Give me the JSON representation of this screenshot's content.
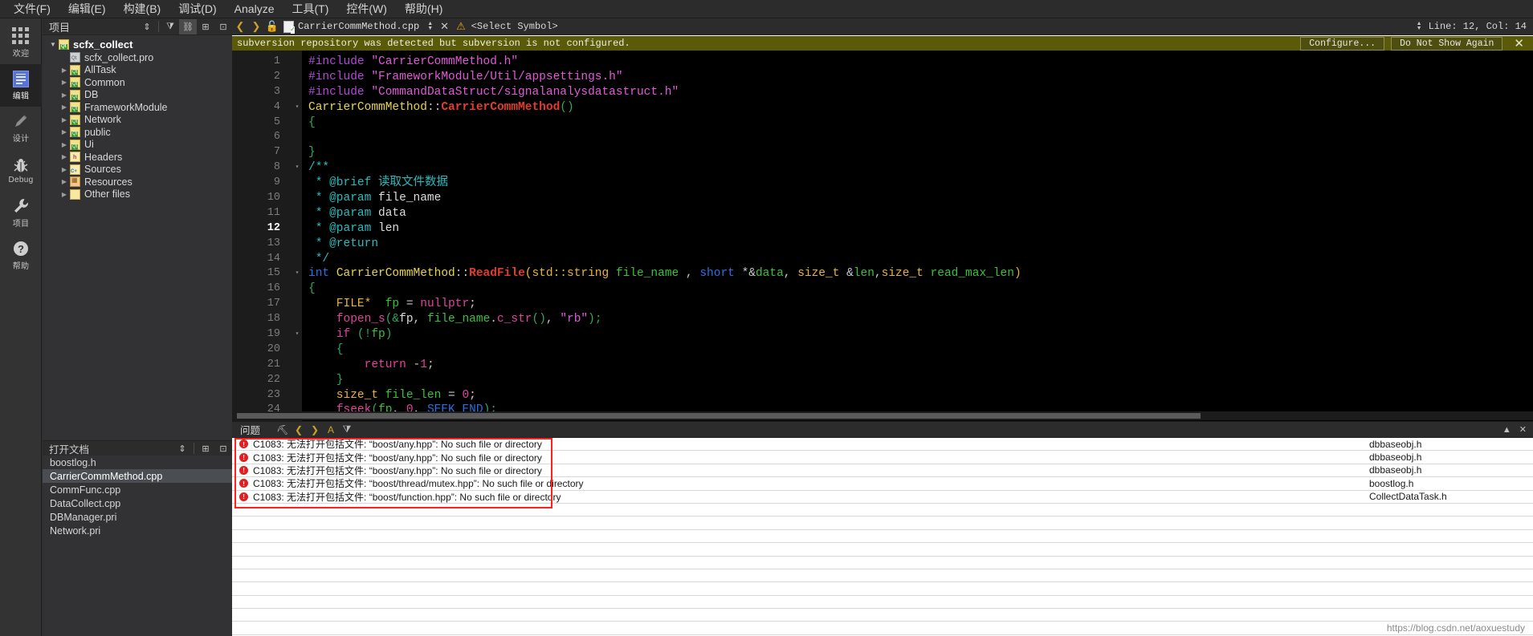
{
  "menubar": {
    "items": [
      {
        "label": "文件(F)"
      },
      {
        "label": "编辑(E)"
      },
      {
        "label": "构建(B)"
      },
      {
        "label": "调试(D)"
      },
      {
        "label": "Analyze"
      },
      {
        "label": "工具(T)"
      },
      {
        "label": "控件(W)"
      },
      {
        "label": "帮助(H)"
      }
    ]
  },
  "modebar": {
    "items": [
      {
        "label": "欢迎",
        "icon": "grid-icon",
        "active": false
      },
      {
        "label": "编辑",
        "icon": "document-icon",
        "active": true
      },
      {
        "label": "设计",
        "icon": "pencil-icon",
        "active": false
      },
      {
        "label": "Debug",
        "icon": "bug-icon",
        "active": false
      },
      {
        "label": "项目",
        "icon": "wrench-icon",
        "active": false
      },
      {
        "label": "帮助",
        "icon": "question-icon",
        "active": false
      }
    ]
  },
  "project_pane": {
    "title": "项目",
    "toolbar": [
      "sort-icon",
      "filter-icon",
      "link-icon",
      "split-icon",
      "close-icon"
    ],
    "tree": [
      {
        "label": "scfx_collect",
        "depth": 0,
        "arrow": "open",
        "icon": "qt-folder",
        "root": true
      },
      {
        "label": "scfx_collect.pro",
        "depth": 1,
        "arrow": "none",
        "icon": "pro-file"
      },
      {
        "label": "AllTask",
        "depth": 1,
        "arrow": "collapsed",
        "icon": "qt-folder"
      },
      {
        "label": "Common",
        "depth": 1,
        "arrow": "collapsed",
        "icon": "qt-folder"
      },
      {
        "label": "DB",
        "depth": 1,
        "arrow": "collapsed",
        "icon": "qt-folder"
      },
      {
        "label": "FrameworkModule",
        "depth": 1,
        "arrow": "collapsed",
        "icon": "qt-folder"
      },
      {
        "label": "Network",
        "depth": 1,
        "arrow": "collapsed",
        "icon": "qt-folder"
      },
      {
        "label": "public",
        "depth": 1,
        "arrow": "collapsed",
        "icon": "qt-folder"
      },
      {
        "label": "Ui",
        "depth": 1,
        "arrow": "collapsed",
        "icon": "qt-folder"
      },
      {
        "label": "Headers",
        "depth": 1,
        "arrow": "collapsed",
        "icon": "h-folder"
      },
      {
        "label": "Sources",
        "depth": 1,
        "arrow": "collapsed",
        "icon": "cpp-folder"
      },
      {
        "label": "Resources",
        "depth": 1,
        "arrow": "collapsed",
        "icon": "res-folder"
      },
      {
        "label": "Other files",
        "depth": 1,
        "arrow": "collapsed",
        "icon": "other-folder"
      }
    ]
  },
  "open_documents": {
    "title": "打开文档",
    "items": [
      {
        "label": "boostlog.h",
        "selected": false
      },
      {
        "label": "CarrierCommMethod.cpp",
        "selected": true
      },
      {
        "label": "CommFunc.cpp",
        "selected": false
      },
      {
        "label": "DataCollect.cpp",
        "selected": false
      },
      {
        "label": "DBManager.pri",
        "selected": false
      },
      {
        "label": "Network.pri",
        "selected": false
      }
    ]
  },
  "editor_toolbar": {
    "back_icon": "chevron-left-icon",
    "forward_icon": "chevron-right-icon",
    "lock_icon": "unlock-icon",
    "filename": "CarrierCommMethod.cpp",
    "close_label": "✕",
    "symbol_selector": "<Select Symbol>",
    "line_col": "Line: 12, Col: 14"
  },
  "info_bar": {
    "message": "subversion repository was detected but subversion is not configured.",
    "configure_label": "Configure...",
    "dismiss_label": "Do Not Show Again",
    "close_label": "✕",
    "background": "#5a5a08"
  },
  "code": {
    "lines": [
      {
        "n": "1",
        "fold": "",
        "cur": false,
        "tokens": [
          {
            "t": "#include ",
            "c": "t-pre"
          },
          {
            "t": "\"CarrierCommMethod.h\"",
            "c": "t-str"
          }
        ]
      },
      {
        "n": "2",
        "fold": "",
        "cur": false,
        "tokens": [
          {
            "t": "#include ",
            "c": "t-pre"
          },
          {
            "t": "\"FrameworkModule/Util/appsettings.h\"",
            "c": "t-str"
          }
        ]
      },
      {
        "n": "3",
        "fold": "",
        "cur": false,
        "tokens": [
          {
            "t": "#include ",
            "c": "t-pre"
          },
          {
            "t": "\"CommandDataStruct/signalanalysdatastruct.h\"",
            "c": "t-str"
          }
        ]
      },
      {
        "n": "4",
        "fold": "▾",
        "cur": false,
        "tokens": [
          {
            "t": "CarrierCommMethod",
            "c": "t-cls"
          },
          {
            "t": "::",
            "c": "t-op"
          },
          {
            "t": "CarrierCommMethod",
            "c": "t-fn"
          },
          {
            "t": "()",
            "c": "t-brace"
          }
        ]
      },
      {
        "n": "5",
        "fold": "",
        "cur": false,
        "tokens": [
          {
            "t": "{",
            "c": "t-brace"
          }
        ]
      },
      {
        "n": "6",
        "fold": "",
        "cur": false,
        "tokens": []
      },
      {
        "n": "7",
        "fold": "",
        "cur": false,
        "tokens": [
          {
            "t": "}",
            "c": "t-brace"
          }
        ]
      },
      {
        "n": "8",
        "fold": "▾",
        "cur": false,
        "tokens": [
          {
            "t": "/**",
            "c": "t-cmt"
          }
        ]
      },
      {
        "n": "9",
        "fold": "",
        "cur": false,
        "tokens": [
          {
            "t": " * @brief 读取文件数据",
            "c": "t-cmt"
          }
        ]
      },
      {
        "n": "10",
        "fold": "",
        "cur": false,
        "tokens": [
          {
            "t": " * @param ",
            "c": "t-cmt"
          },
          {
            "t": "file_name",
            "c": "t-pl"
          }
        ]
      },
      {
        "n": "11",
        "fold": "",
        "cur": false,
        "tokens": [
          {
            "t": " * @param ",
            "c": "t-cmt"
          },
          {
            "t": "data",
            "c": "t-pl"
          }
        ]
      },
      {
        "n": "12",
        "fold": "",
        "cur": true,
        "tokens": [
          {
            "t": " * @param ",
            "c": "t-cmt"
          },
          {
            "t": "len",
            "c": "t-pl"
          }
        ]
      },
      {
        "n": "13",
        "fold": "",
        "cur": false,
        "tokens": [
          {
            "t": " * @return",
            "c": "t-cmt"
          }
        ]
      },
      {
        "n": "14",
        "fold": "",
        "cur": false,
        "tokens": [
          {
            "t": " */",
            "c": "t-cmt"
          }
        ]
      },
      {
        "n": "15",
        "fold": "▾",
        "cur": false,
        "tokens": [
          {
            "t": "int ",
            "c": "t-kw"
          },
          {
            "t": "CarrierCommMethod",
            "c": "t-cls"
          },
          {
            "t": "::",
            "c": "t-op"
          },
          {
            "t": "ReadFile",
            "c": "t-fn"
          },
          {
            "t": "(",
            "c": "t-type"
          },
          {
            "t": "std::string ",
            "c": "t-type"
          },
          {
            "t": "file_name",
            "c": "t-var"
          },
          {
            "t": " , ",
            "c": "t-op"
          },
          {
            "t": "short ",
            "c": "t-kw"
          },
          {
            "t": "*&",
            "c": "t-op"
          },
          {
            "t": "data",
            "c": "t-var"
          },
          {
            "t": ", ",
            "c": "t-op"
          },
          {
            "t": "size_t ",
            "c": "t-type"
          },
          {
            "t": "&",
            "c": "t-op"
          },
          {
            "t": "len",
            "c": "t-var"
          },
          {
            "t": ",",
            "c": "t-op"
          },
          {
            "t": "size_t ",
            "c": "t-type"
          },
          {
            "t": "read_max_len",
            "c": "t-var"
          },
          {
            "t": ")",
            "c": "t-type"
          }
        ]
      },
      {
        "n": "16",
        "fold": "",
        "cur": false,
        "tokens": [
          {
            "t": "{",
            "c": "t-brace"
          }
        ]
      },
      {
        "n": "17",
        "fold": "",
        "cur": false,
        "tokens": [
          {
            "t": "    FILE*",
            "c": "t-type"
          },
          {
            "t": "  ",
            "c": "t-op"
          },
          {
            "t": "fp",
            "c": "t-var"
          },
          {
            "t": " = ",
            "c": "t-op"
          },
          {
            "t": "nullptr",
            "c": "t-num"
          },
          {
            "t": ";",
            "c": "t-op"
          }
        ]
      },
      {
        "n": "18",
        "fold": "",
        "cur": false,
        "tokens": [
          {
            "t": "    ",
            "c": "t-op"
          },
          {
            "t": "fopen_s",
            "c": "t-fnp"
          },
          {
            "t": "(&",
            "c": "t-brace"
          },
          {
            "t": "fp",
            "c": "t-pl"
          },
          {
            "t": ", ",
            "c": "t-op"
          },
          {
            "t": "file_name",
            "c": "t-var"
          },
          {
            "t": ".",
            "c": "t-op"
          },
          {
            "t": "c_str",
            "c": "t-fnp"
          },
          {
            "t": "()",
            "c": "t-brace"
          },
          {
            "t": ", ",
            "c": "t-op"
          },
          {
            "t": "\"rb\"",
            "c": "t-str"
          },
          {
            "t": ");",
            "c": "t-brace"
          }
        ]
      },
      {
        "n": "19",
        "fold": "▾",
        "cur": false,
        "tokens": [
          {
            "t": "    ",
            "c": "t-op"
          },
          {
            "t": "if ",
            "c": "t-fnp"
          },
          {
            "t": "(!",
            "c": "t-brace"
          },
          {
            "t": "fp",
            "c": "t-var"
          },
          {
            "t": ")",
            "c": "t-brace"
          }
        ]
      },
      {
        "n": "20",
        "fold": "",
        "cur": false,
        "tokens": [
          {
            "t": "    {",
            "c": "t-brace"
          }
        ]
      },
      {
        "n": "21",
        "fold": "",
        "cur": false,
        "tokens": [
          {
            "t": "        ",
            "c": "t-op"
          },
          {
            "t": "return ",
            "c": "t-fnp"
          },
          {
            "t": "-",
            "c": "t-op"
          },
          {
            "t": "1",
            "c": "t-num"
          },
          {
            "t": ";",
            "c": "t-op"
          }
        ]
      },
      {
        "n": "22",
        "fold": "",
        "cur": false,
        "tokens": [
          {
            "t": "    }",
            "c": "t-brace"
          }
        ]
      },
      {
        "n": "23",
        "fold": "",
        "cur": false,
        "tokens": [
          {
            "t": "    size_t ",
            "c": "t-type"
          },
          {
            "t": "file_len",
            "c": "t-var"
          },
          {
            "t": " = ",
            "c": "t-op"
          },
          {
            "t": "0",
            "c": "t-num"
          },
          {
            "t": ";",
            "c": "t-op"
          }
        ]
      },
      {
        "n": "24",
        "fold": "",
        "cur": false,
        "tokens": [
          {
            "t": "    ",
            "c": "t-op"
          },
          {
            "t": "fseek",
            "c": "t-fnp"
          },
          {
            "t": "(",
            "c": "t-brace"
          },
          {
            "t": "fp",
            "c": "t-var"
          },
          {
            "t": ", ",
            "c": "t-op"
          },
          {
            "t": "0",
            "c": "t-num"
          },
          {
            "t": ", ",
            "c": "t-op"
          },
          {
            "t": "SEEK_END",
            "c": "t-en"
          },
          {
            "t": ");",
            "c": "t-brace"
          }
        ]
      }
    ]
  },
  "issues_panel": {
    "tab_label": "问题",
    "toolbar_icons": [
      "clear-icon",
      "prev-issue-icon",
      "next-issue-icon",
      "warning-filter-icon",
      "filter-icon"
    ],
    "columns": [
      "message",
      "file"
    ],
    "rows": [
      {
        "severity": "error",
        "message": "C1083: 无法打开包括文件: “boost/any.hpp”: No such file or directory",
        "file": "dbbaseobj.h"
      },
      {
        "severity": "error",
        "message": "C1083: 无法打开包括文件: “boost/any.hpp”: No such file or directory",
        "file": "dbbaseobj.h"
      },
      {
        "severity": "error",
        "message": "C1083: 无法打开包括文件: “boost/any.hpp”: No such file or directory",
        "file": "dbbaseobj.h"
      },
      {
        "severity": "error",
        "message": "C1083: 无法打开包括文件: “boost/thread/mutex.hpp”: No such file or directory",
        "file": "boostlog.h"
      },
      {
        "severity": "error",
        "message": "C1083: 无法打开包括文件: “boost/function.hpp”: No such file or directory",
        "file": "CollectDataTask.h"
      }
    ]
  },
  "watermark": {
    "text": "https://blog.csdn.net/aoxuestudy"
  }
}
